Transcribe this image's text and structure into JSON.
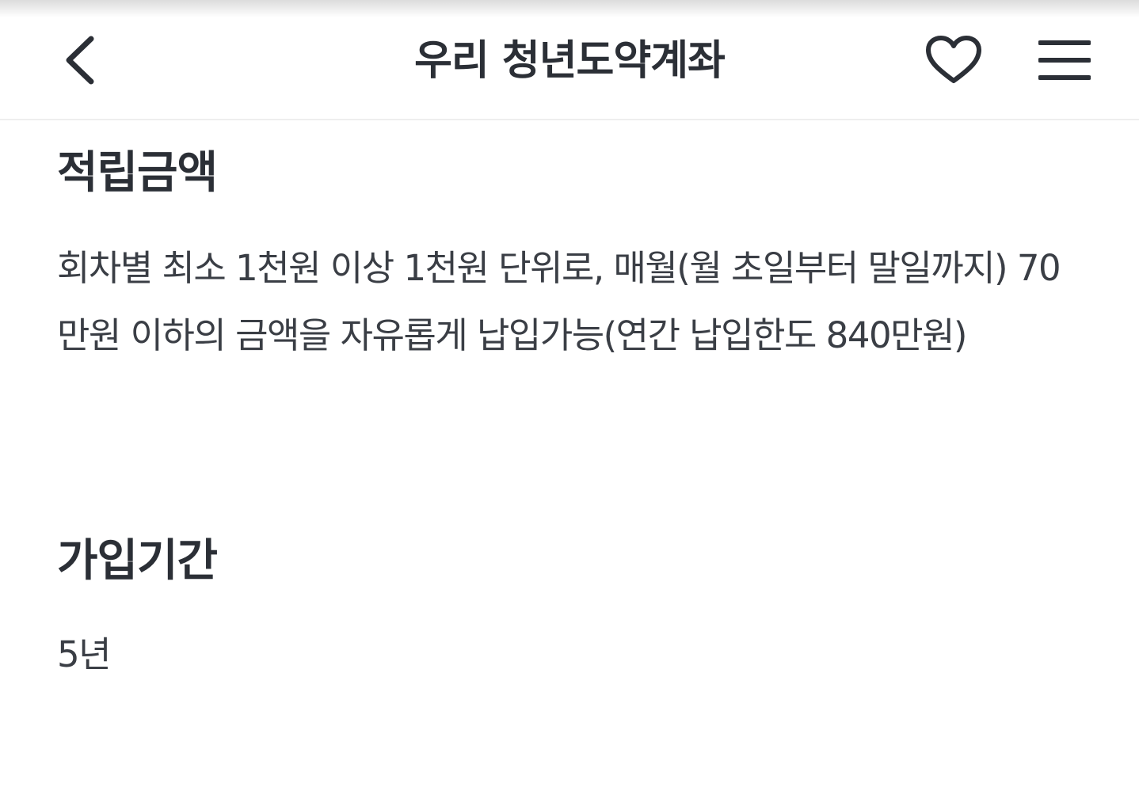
{
  "header": {
    "title": "우리 청년도약계좌",
    "back_icon": "chevron-left-icon",
    "favorite_icon": "heart-outline-icon",
    "menu_icon": "hamburger-menu-icon"
  },
  "sections": [
    {
      "title": "적립금액",
      "body": "회차별 최소 1천원 이상 1천원 단위로, 매월(월 초일부터 말일까지) 70만원 이하의 금액을 자유롭게 납입가능(연간 납입한도 840만원)"
    },
    {
      "title": "가입기간",
      "body": "5년"
    }
  ],
  "colors": {
    "text_primary": "#2b2f36",
    "text_body": "#3a3e45",
    "divider": "#eeeeee"
  }
}
